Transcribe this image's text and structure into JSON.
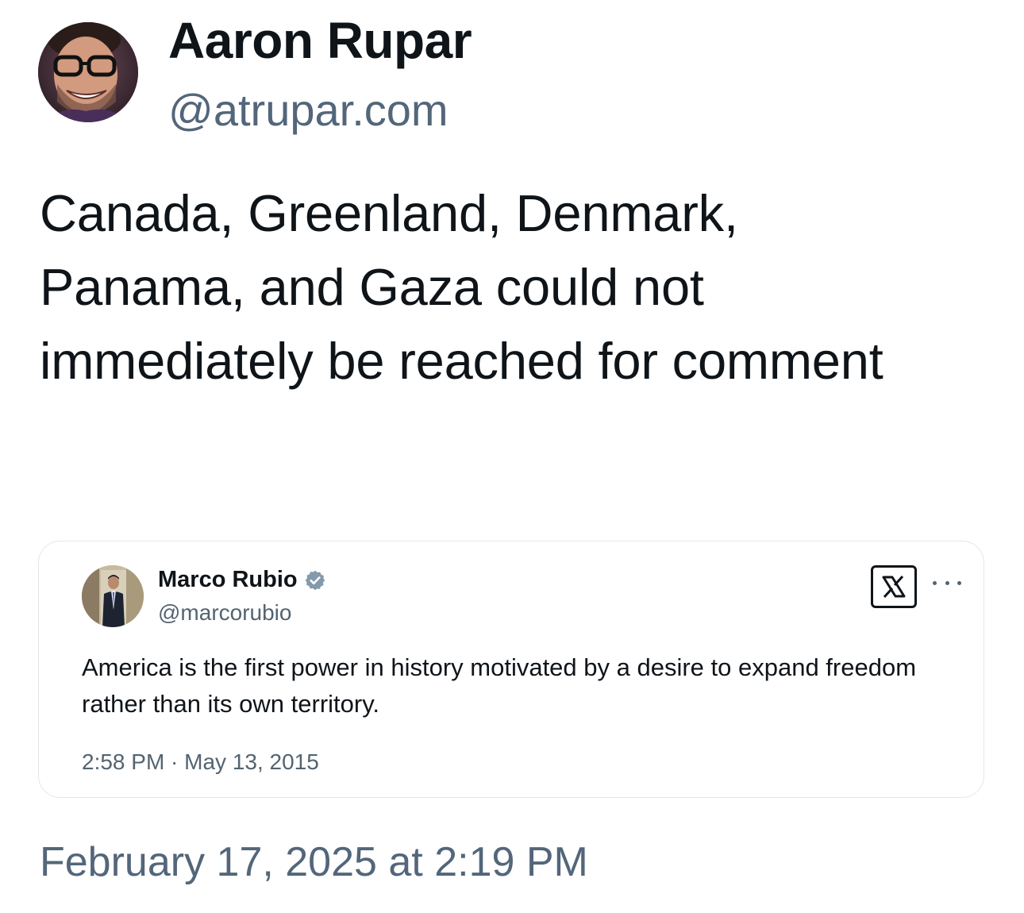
{
  "post": {
    "author": {
      "name": "Aaron Rupar",
      "handle": "@atrupar.com",
      "avatar_icon": "avatar-photo-smiling-man-glasses"
    },
    "text": "Canada, Greenland, Denmark, Panama, and Gaza could not immediately be reached for comment",
    "timestamp": "February 17, 2025 at 2:19 PM"
  },
  "quoted_post": {
    "author": {
      "name": "Marco Rubio",
      "handle": "@marcorubio",
      "verified": true,
      "avatar_icon": "avatar-photo-man-in-suit"
    },
    "text": "America is the first power in history motivated by a desire to expand freedom rather than its own territory.",
    "timestamp": "2:58 PM · May 13, 2015",
    "source_icon": "x-logo-icon",
    "menu_icon": "more-options-icon"
  },
  "colors": {
    "text_primary": "#0f1419",
    "text_secondary": "#536471",
    "verified_badge": "#829aab",
    "card_border": "#e3e7ea",
    "background": "#ffffff"
  }
}
